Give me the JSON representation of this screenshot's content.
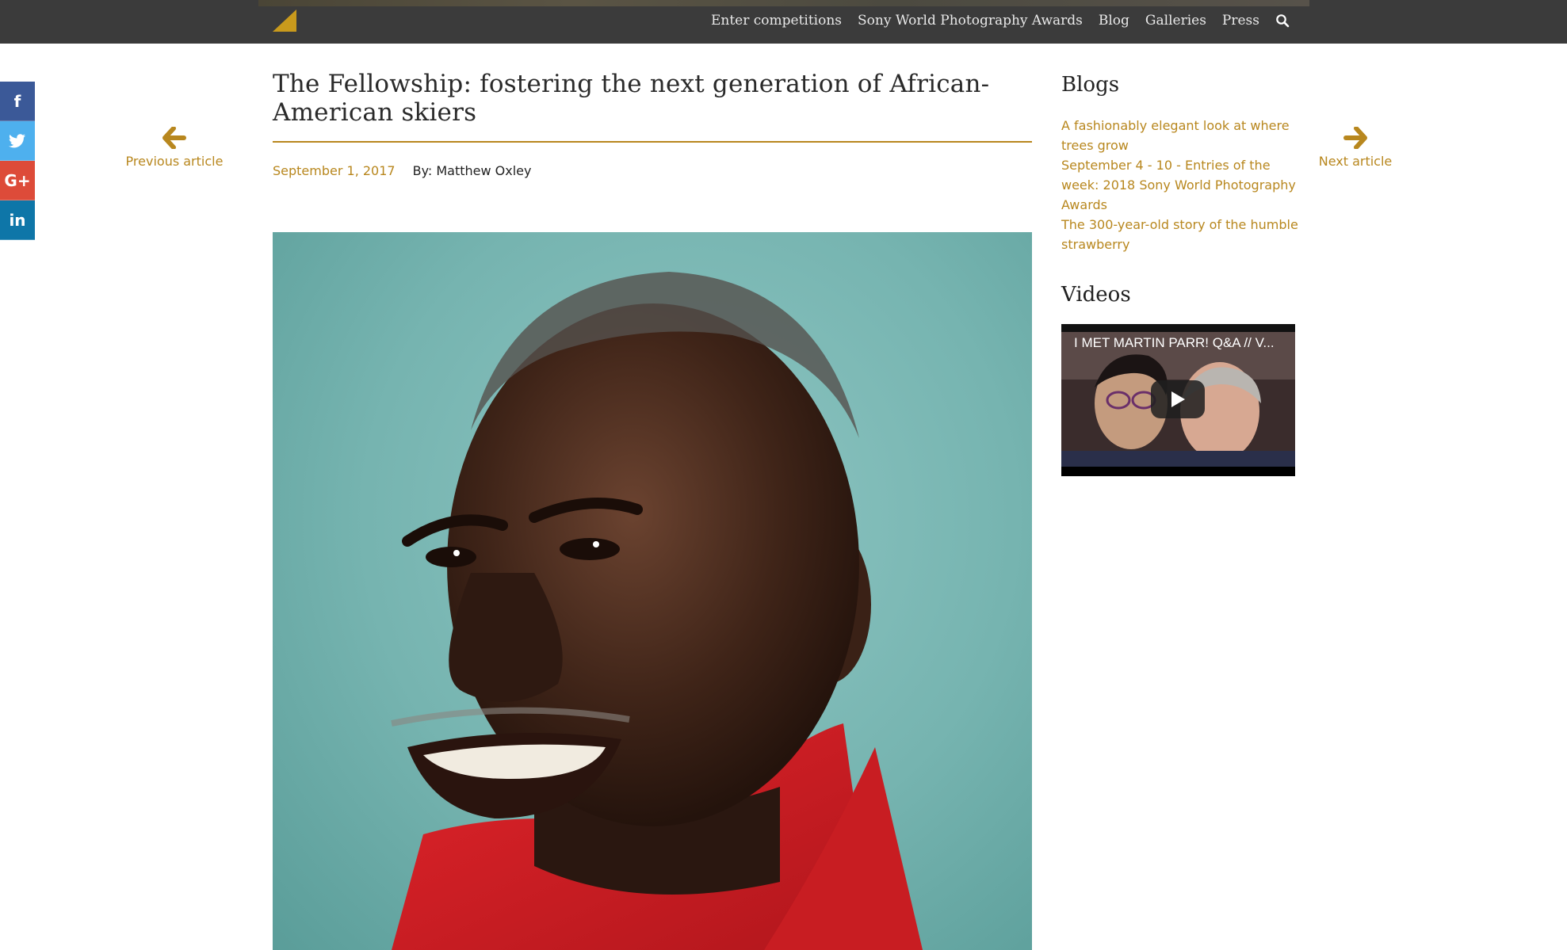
{
  "nav": {
    "items": [
      "Enter competitions",
      "Sony World Photography Awards",
      "Blog",
      "Galleries",
      "Press"
    ]
  },
  "social": [
    "f",
    "t",
    "G+",
    "in"
  ],
  "pager": {
    "prev": "Previous article",
    "next": "Next article"
  },
  "article": {
    "title": "The Fellowship: fostering the next generation of African-American skiers",
    "date": "September 1, 2017",
    "byline": "By: Matthew Oxley"
  },
  "sidebar": {
    "blogs_heading": "Blogs",
    "blogs": [
      "A fashionably elegant look at where trees grow",
      "September 4 - 10 - Entries of the week: 2018 Sony World Photography Awards",
      "The 300-year-old story of the humble strawberry"
    ],
    "videos_heading": "Videos",
    "video_title": "I MET MARTIN PARR! Q&A // V..."
  },
  "colors": {
    "accent": "#b8871e",
    "topbar": "#3b3b3b"
  }
}
